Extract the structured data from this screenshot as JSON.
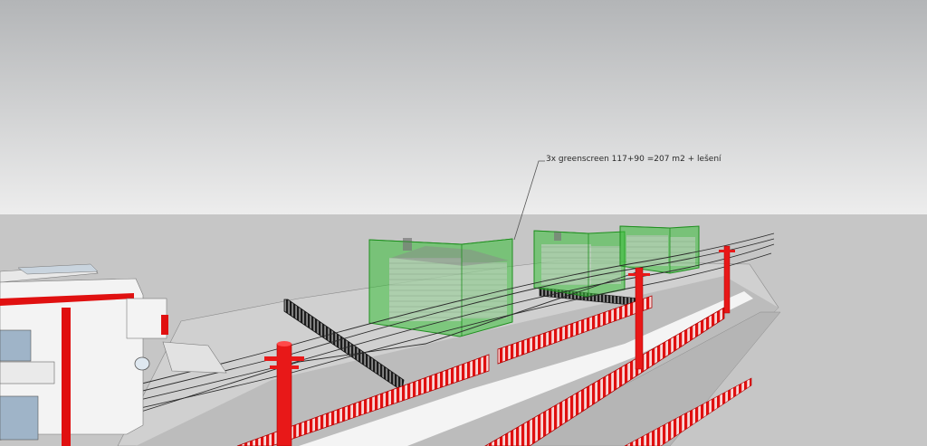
{
  "annotation": {
    "text": "3x greenscreen 117+90 =207 m2 + lešení"
  },
  "colors": {
    "sky_top": "#b4b6b8",
    "sky_bottom": "#eeeeee",
    "ground": "#c6c6c6",
    "street": "#b8b8b8",
    "greenscreen_fill": "#3ec43e",
    "greenscreen_stroke": "#1f8f1f",
    "fence_red": "#e01010",
    "pole_red": "#e81818",
    "house_white": "#f3f3f3"
  },
  "scene": {
    "objects": [
      "white-villa",
      "greenscreen-box",
      "greenscreen-box",
      "greenscreen-box",
      "red-fence",
      "utility-pole",
      "utility-pole",
      "utility-pole",
      "overhead-wires",
      "black-fence"
    ]
  }
}
